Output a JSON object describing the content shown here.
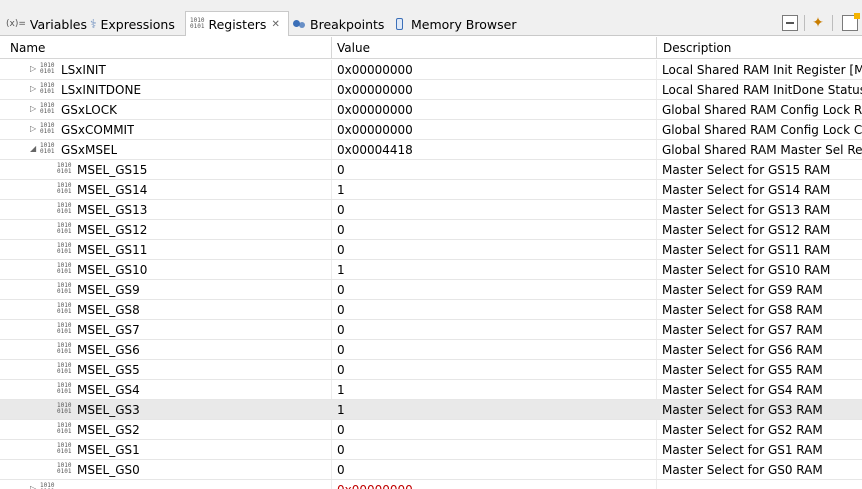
{
  "tabs": [
    {
      "icon": "variables-icon",
      "icon_text": "(x)=",
      "label": "Variables"
    },
    {
      "icon": "expressions-icon",
      "icon_text": "⚕",
      "label": "Expressions"
    },
    {
      "icon": "registers-icon",
      "label": "Registers",
      "active": true
    },
    {
      "icon": "breakpoints-icon",
      "label": "Breakpoints"
    },
    {
      "icon": "memory-browser-icon",
      "label": "Memory Browser"
    }
  ],
  "columns": {
    "name": "Name",
    "value": "Value",
    "description": "Description"
  },
  "rows": [
    {
      "level": 1,
      "expand": "collapsed",
      "name": "LSxINIT",
      "value": "0x00000000",
      "desc": "Local Shared RAM Init Register [M"
    },
    {
      "level": 1,
      "expand": "collapsed",
      "name": "LSxINITDONE",
      "value": "0x00000000",
      "desc": "Local Shared RAM InitDone Status"
    },
    {
      "level": 1,
      "expand": "collapsed",
      "name": "GSxLOCK",
      "value": "0x00000000",
      "desc": "Global Shared RAM Config Lock R"
    },
    {
      "level": 1,
      "expand": "collapsed",
      "name": "GSxCOMMIT",
      "value": "0x00000000",
      "desc": "Global Shared RAM Config Lock C"
    },
    {
      "level": 1,
      "expand": "expanded",
      "name": "GSxMSEL",
      "value": "0x00004418",
      "desc": "Global Shared RAM Master Sel Re"
    },
    {
      "level": 2,
      "name": "MSEL_GS15",
      "value": "0",
      "desc": "Master Select for GS15 RAM"
    },
    {
      "level": 2,
      "name": "MSEL_GS14",
      "value": "1",
      "desc": "Master Select for GS14 RAM"
    },
    {
      "level": 2,
      "name": "MSEL_GS13",
      "value": "0",
      "desc": "Master Select for GS13 RAM"
    },
    {
      "level": 2,
      "name": "MSEL_GS12",
      "value": "0",
      "desc": "Master Select for GS12 RAM"
    },
    {
      "level": 2,
      "name": "MSEL_GS11",
      "value": "0",
      "desc": "Master Select for GS11 RAM"
    },
    {
      "level": 2,
      "name": "MSEL_GS10",
      "value": "1",
      "desc": "Master Select for GS10 RAM"
    },
    {
      "level": 2,
      "name": "MSEL_GS9",
      "value": "0",
      "desc": "Master Select for GS9 RAM"
    },
    {
      "level": 2,
      "name": "MSEL_GS8",
      "value": "0",
      "desc": "Master Select for GS8 RAM"
    },
    {
      "level": 2,
      "name": "MSEL_GS7",
      "value": "0",
      "desc": "Master Select for GS7 RAM"
    },
    {
      "level": 2,
      "name": "MSEL_GS6",
      "value": "0",
      "desc": "Master Select for GS6 RAM"
    },
    {
      "level": 2,
      "name": "MSEL_GS5",
      "value": "0",
      "desc": "Master Select for GS5 RAM"
    },
    {
      "level": 2,
      "name": "MSEL_GS4",
      "value": "1",
      "desc": "Master Select for GS4 RAM"
    },
    {
      "level": 2,
      "name": "MSEL_GS3",
      "value": "1",
      "desc": "Master Select for GS3 RAM",
      "selected": true
    },
    {
      "level": 2,
      "name": "MSEL_GS2",
      "value": "0",
      "desc": "Master Select for GS2 RAM"
    },
    {
      "level": 2,
      "name": "MSEL_GS1",
      "value": "0",
      "desc": "Master Select for GS1 RAM"
    },
    {
      "level": 2,
      "name": "MSEL_GS0",
      "value": "0",
      "desc": "Master Select for GS0 RAM"
    },
    {
      "level": 1,
      "expand": "collapsed",
      "name": "",
      "value": "0x00000000",
      "desc": "",
      "partial": true
    }
  ],
  "colors": {
    "selected_row": "#e9e9e9",
    "changed_value": "#c00000"
  }
}
